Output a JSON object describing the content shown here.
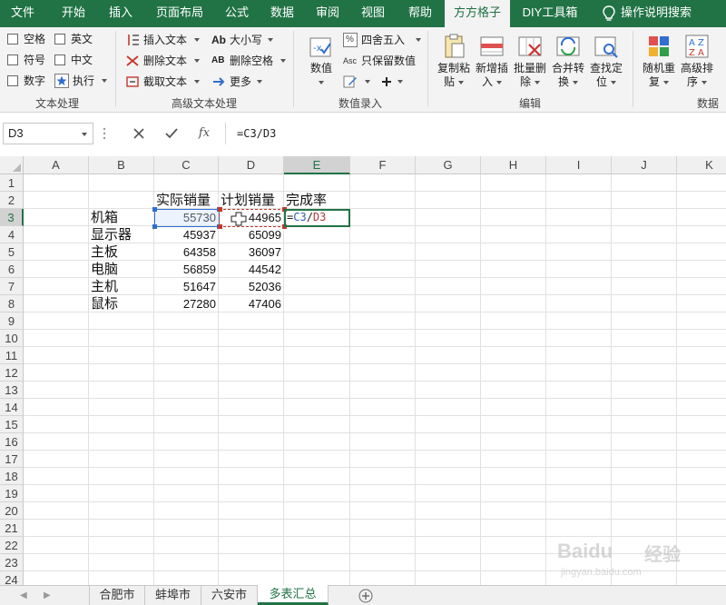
{
  "ribbon_tabs": [
    {
      "label": "文件",
      "active": false
    },
    {
      "label": "开始",
      "active": false
    },
    {
      "label": "插入",
      "active": false
    },
    {
      "label": "页面布局",
      "active": false
    },
    {
      "label": "公式",
      "active": false
    },
    {
      "label": "数据",
      "active": false
    },
    {
      "label": "审阅",
      "active": false
    },
    {
      "label": "视图",
      "active": false
    },
    {
      "label": "帮助",
      "active": false
    },
    {
      "label": "方方格子",
      "active": true
    },
    {
      "label": "DIY工具箱",
      "active": false
    }
  ],
  "tell_me": {
    "label": "操作说明搜索",
    "icon": "lightbulb-icon"
  },
  "text_group": {
    "label": "文本处理",
    "checkboxes": [
      {
        "label": "空格",
        "checked": false
      },
      {
        "label": "英文",
        "checked": false
      },
      {
        "label": "符号",
        "checked": false
      },
      {
        "label": "中文",
        "checked": false
      },
      {
        "label": "数字",
        "checked": false
      }
    ],
    "run_label": "执行"
  },
  "advanced_group": {
    "label": "高级文本处理",
    "insert_text": "插入文本",
    "delete_text": "删除文本",
    "extract_text": "截取文本",
    "case_label": "大小写",
    "case_icon_text": "Ab",
    "delete_space": "删除空格",
    "delete_space_icon_text": "AB",
    "more": "更多"
  },
  "numeric_group": {
    "label": "数值录入",
    "value_label": "数值",
    "round_label": "四舍五入",
    "round_icon_text": "%",
    "keep_value": "只保留数值",
    "keep_value_icon_text": "Asc"
  },
  "edit_group": {
    "label": "编辑",
    "buttons": [
      {
        "line1": "复制粘",
        "line2": "贴"
      },
      {
        "line1": "新增插",
        "line2": "入"
      },
      {
        "line1": "批量删",
        "line2": "除"
      },
      {
        "line1": "合并转",
        "line2": "换"
      },
      {
        "line1": "查找定",
        "line2": "位"
      }
    ]
  },
  "data_group": {
    "label": "数据",
    "buttons": [
      {
        "line1": "随机重",
        "line2": "复"
      },
      {
        "line1": "高级排",
        "line2": "序"
      }
    ]
  },
  "formula_bar": {
    "name_box": "D3",
    "cancel_icon": "close-icon",
    "enter_icon": "check-icon",
    "fx_label": "fx",
    "formula": "=C3/D3"
  },
  "columns": [
    "A",
    "B",
    "C",
    "D",
    "E",
    "F",
    "G",
    "H",
    "I",
    "J",
    "K"
  ],
  "rows": [
    "1",
    "2",
    "3",
    "4",
    "5",
    "6",
    "7",
    "8",
    "9",
    "10",
    "11",
    "12",
    "13",
    "14",
    "15",
    "16",
    "17",
    "18",
    "19",
    "20",
    "21",
    "22",
    "23",
    "24"
  ],
  "headers": {
    "actual": "实际销量",
    "plan": "计划销量",
    "rate": "完成率"
  },
  "products": [
    {
      "name": "机箱",
      "actual": "55730",
      "plan": "44965"
    },
    {
      "name": "显示器",
      "actual": "45937",
      "plan": "65099"
    },
    {
      "name": "主板",
      "actual": "64358",
      "plan": "36097"
    },
    {
      "name": "电脑",
      "actual": "56859",
      "plan": "44542"
    },
    {
      "name": "主机",
      "actual": "51647",
      "plan": "52036"
    },
    {
      "name": "鼠标",
      "actual": "27280",
      "plan": "47406"
    }
  ],
  "editing_formula": {
    "eq": "=",
    "ref1": "C3",
    "op": "/",
    "ref2": "D3"
  },
  "sheets": [
    {
      "label": "合肥市",
      "active": false
    },
    {
      "label": "蚌埠市",
      "active": false
    },
    {
      "label": "六安市",
      "active": false
    },
    {
      "label": "多表汇总",
      "active": true
    }
  ],
  "watermark": {
    "logo": "Baidu",
    "cn": "经验",
    "sub": "jingyan.baidu.com"
  },
  "colors": {
    "accent": "#217346",
    "ref_blue": "#2f5fb0",
    "ref_red": "#b03a3a"
  }
}
